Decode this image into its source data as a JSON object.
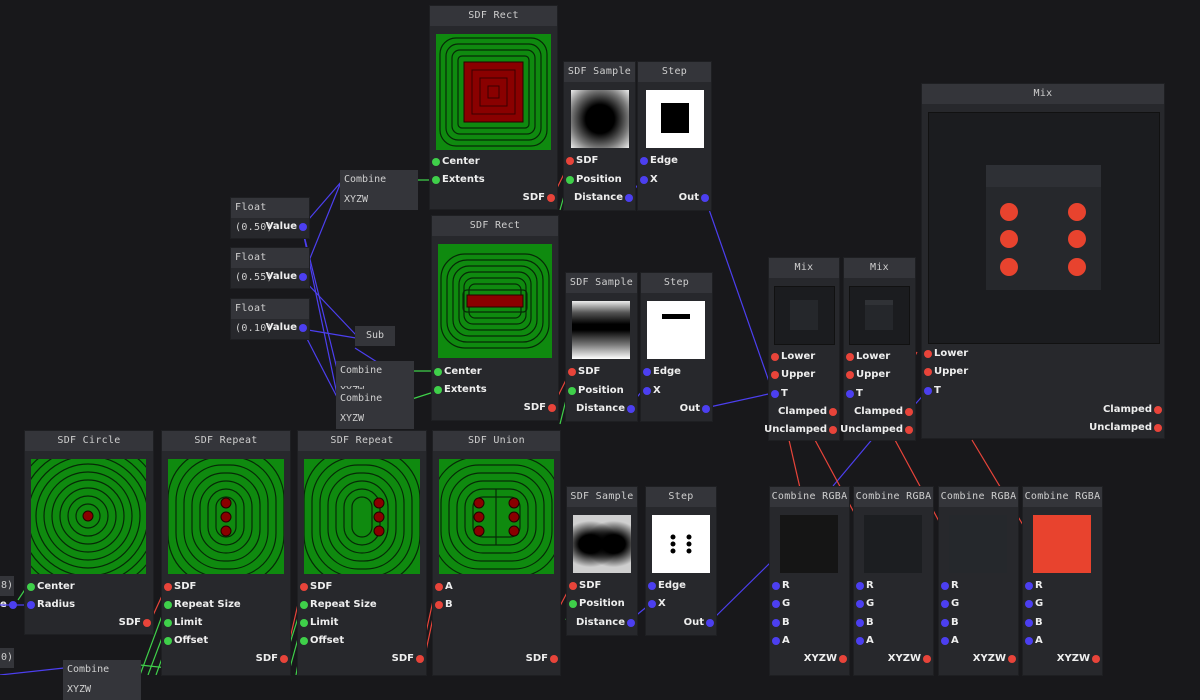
{
  "colors": {
    "red": "#e8443a",
    "green": "#3fd04a",
    "blue": "#4c3ff0",
    "node_bg": "#27282c",
    "title_bg": "#34353a",
    "canvas_bg": "#18181b"
  },
  "nodes": {
    "sdf_rect_1": {
      "title": "SDF Rect",
      "inputs": [
        "Center",
        "Extents"
      ],
      "output": "SDF"
    },
    "sdf_rect_2": {
      "title": "SDF Rect",
      "inputs": [
        "Center",
        "Extents"
      ],
      "output": "SDF"
    },
    "sdf_sample_1": {
      "title": "SDF Sample",
      "inputs": [
        "SDF",
        "Position"
      ],
      "output": "Distance"
    },
    "sdf_sample_2": {
      "title": "SDF Sample",
      "inputs": [
        "SDF",
        "Position"
      ],
      "output": "Distance"
    },
    "sdf_sample_3": {
      "title": "SDF Sample",
      "inputs": [
        "SDF",
        "Position"
      ],
      "output": "Distance"
    },
    "step_1": {
      "title": "Step",
      "inputs": [
        "Edge",
        "X"
      ],
      "output": "Out"
    },
    "step_2": {
      "title": "Step",
      "inputs": [
        "Edge",
        "X"
      ],
      "output": "Out"
    },
    "step_3": {
      "title": "Step",
      "inputs": [
        "Edge",
        "X"
      ],
      "output": "Out"
    },
    "mix_big": {
      "title": "Mix",
      "inputs": [
        "Lower",
        "Upper",
        "T"
      ],
      "outputs": [
        "Clamped",
        "Unclamped"
      ]
    },
    "mix_1": {
      "title": "Mix",
      "inputs": [
        "Lower",
        "Upper",
        "T"
      ],
      "outputs": [
        "Clamped",
        "Unclamped"
      ]
    },
    "mix_2": {
      "title": "Mix",
      "inputs": [
        "Lower",
        "Upper",
        "T"
      ],
      "outputs": [
        "Clamped",
        "Unclamped"
      ]
    },
    "sdf_circle": {
      "title": "SDF Circle",
      "inputs": [
        "Center",
        "Radius"
      ],
      "output": "SDF"
    },
    "sdf_repeat_1": {
      "title": "SDF Repeat",
      "inputs": [
        "SDF",
        "Repeat Size",
        "Limit",
        "Offset"
      ],
      "output": "SDF"
    },
    "sdf_repeat_2": {
      "title": "SDF Repeat",
      "inputs": [
        "SDF",
        "Repeat Size",
        "Limit",
        "Offset"
      ],
      "output": "SDF"
    },
    "sdf_union": {
      "title": "SDF Union",
      "inputs": [
        "A",
        "B"
      ],
      "output": "SDF"
    },
    "combine_rgba_1": {
      "title": "Combine RGBA",
      "inputs": [
        "R",
        "G",
        "B",
        "A"
      ],
      "output": "XYZW",
      "swatch": "#151515"
    },
    "combine_rgba_2": {
      "title": "Combine RGBA",
      "inputs": [
        "R",
        "G",
        "B",
        "A"
      ],
      "output": "XYZW",
      "swatch": "#1c1e21"
    },
    "combine_rgba_3": {
      "title": "Combine RGBA",
      "inputs": [
        "R",
        "G",
        "B",
        "A"
      ],
      "output": "XYZW",
      "swatch": "#25282c"
    },
    "combine_rgba_4": {
      "title": "Combine RGBA",
      "inputs": [
        "R",
        "G",
        "B",
        "A"
      ],
      "output": "XYZW",
      "swatch": "#e8432e"
    }
  },
  "float_nodes": [
    {
      "title": "Float (0.50)",
      "output": "Value"
    },
    {
      "title": "Float (0.55)",
      "output": "Value"
    },
    {
      "title": "Float (0.10)",
      "output": "Value"
    }
  ],
  "small_nodes": {
    "combine_xyzw_1": "Combine XYZW",
    "combine_xyzw_2": "Combine XYZW",
    "combine_xyzw_3": "Combine XYZW",
    "combine_xyzw_4": "Combine XYZW",
    "sub": "Sub"
  },
  "edge_fragments": {
    "left_top": "8)",
    "left_bottom": "0)",
    "left_value_tail": "e"
  }
}
